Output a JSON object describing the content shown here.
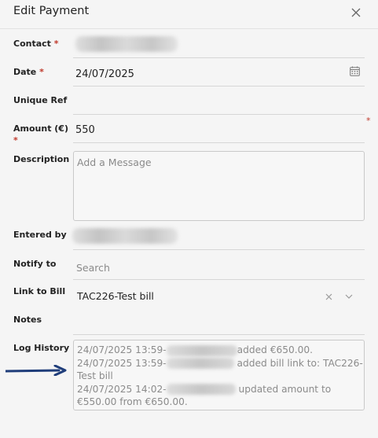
{
  "dialog": {
    "title": "Edit Payment"
  },
  "fields": {
    "contact": {
      "label": "Contact",
      "required_mark": "*"
    },
    "date": {
      "label": "Date",
      "required_mark": "*",
      "value": "24/07/2025"
    },
    "unique_ref": {
      "label": "Unique Ref",
      "value": ""
    },
    "amount": {
      "label": "Amount (€)",
      "required_mark": "*",
      "value": "550"
    },
    "description": {
      "label": "Description",
      "placeholder": "Add a Message"
    },
    "entered_by": {
      "label": "Entered by"
    },
    "notify_to": {
      "label": "Notify to",
      "placeholder": "Search"
    },
    "link_to_bill": {
      "label": "Link to Bill",
      "value": "TAC226-Test bill"
    },
    "notes": {
      "label": "Notes",
      "value": ""
    },
    "log_history": {
      "label": "Log History",
      "lines": [
        {
          "prefix": "24/07/2025 13:59-",
          "suffix": "added €650.00."
        },
        {
          "prefix": "24/07/2025 13:59-",
          "suffix": " added bill link to: TAC226-"
        },
        {
          "prefix": "",
          "suffix": "Test bill"
        },
        {
          "prefix": "24/07/2025 14:02-",
          "suffix": " updated amount to"
        },
        {
          "prefix": "",
          "suffix": "€550.00 from €650.00."
        }
      ]
    }
  },
  "icons": {
    "close": "close-icon",
    "calendar": "calendar-icon",
    "clear": "clear-icon",
    "dropdown": "chevron-down-icon",
    "arrow": "arrow-right-icon"
  },
  "colors": {
    "required": "#c0392b",
    "arrow": "#1f3d7a",
    "muted_text": "#8a8a8a"
  }
}
